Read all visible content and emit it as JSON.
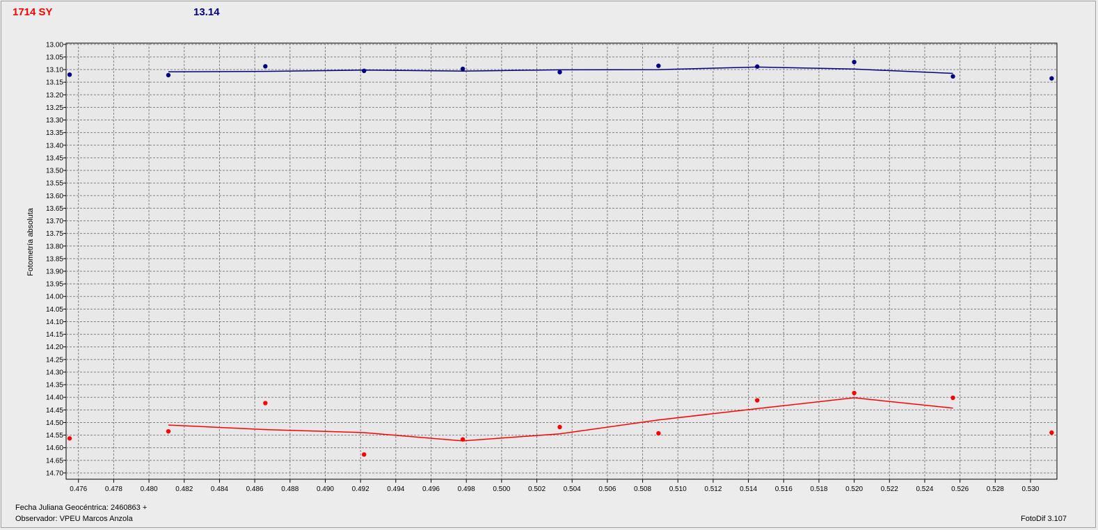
{
  "header": {
    "star_label": "1714 SY",
    "comparison_mag": "13.14"
  },
  "footer": {
    "julian_date": "Fecha Juliana Geocéntrica: 2460863 +",
    "observer": "Observador: VPEU Marcos Anzola",
    "software": "FotoDif 3.107"
  },
  "chart_data": {
    "type": "scatter",
    "ylabel": "Fotometría absoluta",
    "xlabel": "",
    "xlim": [
      0.4753,
      0.5315
    ],
    "ylim": [
      14.725,
      12.995
    ],
    "y_inverted": true,
    "grid": true,
    "x_ticks": [
      "0.476",
      "0.478",
      "0.480",
      "0.482",
      "0.484",
      "0.486",
      "0.488",
      "0.490",
      "0.492",
      "0.494",
      "0.496",
      "0.498",
      "0.500",
      "0.502",
      "0.504",
      "0.506",
      "0.508",
      "0.510",
      "0.512",
      "0.514",
      "0.516",
      "0.518",
      "0.520",
      "0.522",
      "0.524",
      "0.526",
      "0.528",
      "0.530"
    ],
    "y_ticks": [
      "13.00",
      "13.05",
      "13.10",
      "13.15",
      "13.20",
      "13.25",
      "13.30",
      "13.35",
      "13.40",
      "13.45",
      "13.50",
      "13.55",
      "13.60",
      "13.65",
      "13.70",
      "13.75",
      "13.80",
      "13.85",
      "13.90",
      "13.95",
      "14.00",
      "14.05",
      "14.10",
      "14.15",
      "14.20",
      "14.25",
      "14.30",
      "14.35",
      "14.40",
      "14.45",
      "14.50",
      "14.55",
      "14.60",
      "14.65",
      "14.70"
    ],
    "series": [
      {
        "color": "#000080",
        "points": [
          [
            0.4755,
            13.12
          ],
          [
            0.4811,
            13.122
          ],
          [
            0.4866,
            13.087
          ],
          [
            0.4922,
            13.105
          ],
          [
            0.4978,
            13.097
          ],
          [
            0.5033,
            13.11
          ],
          [
            0.5089,
            13.085
          ],
          [
            0.5145,
            13.088
          ],
          [
            0.52,
            13.07
          ],
          [
            0.5256,
            13.127
          ],
          [
            0.5312,
            13.135
          ]
        ],
        "trend": [
          [
            0.4811,
            13.109
          ],
          [
            0.4866,
            13.107
          ],
          [
            0.4922,
            13.102
          ],
          [
            0.4978,
            13.106
          ],
          [
            0.5033,
            13.101
          ],
          [
            0.5089,
            13.1
          ],
          [
            0.5145,
            13.09
          ],
          [
            0.52,
            13.098
          ],
          [
            0.5256,
            13.115
          ]
        ]
      },
      {
        "color": "#ff0000",
        "points": [
          [
            0.4755,
            14.563
          ],
          [
            0.4811,
            14.535
          ],
          [
            0.4866,
            14.423
          ],
          [
            0.4922,
            14.627
          ],
          [
            0.4978,
            14.567
          ],
          [
            0.5033,
            14.518
          ],
          [
            0.5089,
            14.543
          ],
          [
            0.5145,
            14.412
          ],
          [
            0.52,
            14.383
          ],
          [
            0.5256,
            14.402
          ],
          [
            0.5312,
            14.54
          ]
        ],
        "trend": [
          [
            0.4811,
            14.51
          ],
          [
            0.4866,
            14.528
          ],
          [
            0.4922,
            14.54
          ],
          [
            0.4978,
            14.573
          ],
          [
            0.5033,
            14.545
          ],
          [
            0.5089,
            14.49
          ],
          [
            0.5145,
            14.445
          ],
          [
            0.52,
            14.402
          ],
          [
            0.5256,
            14.443
          ]
        ]
      }
    ]
  }
}
